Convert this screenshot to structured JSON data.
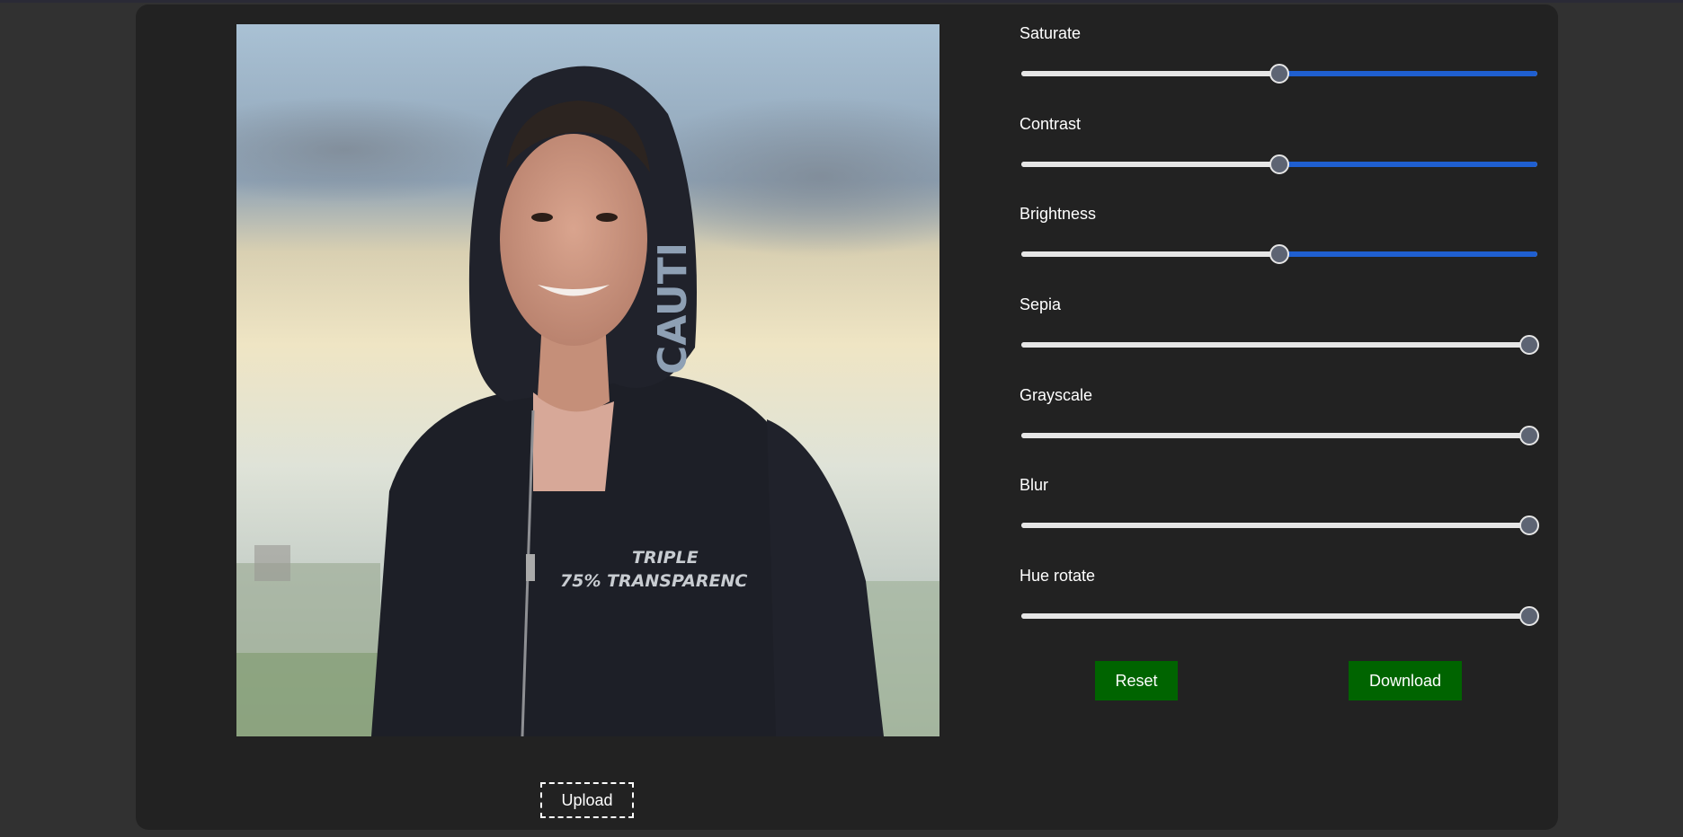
{
  "image": {
    "alt_caption_printed_on_hoodie": "TRIPLE",
    "hoodie_line2": "75% TRANSPARENC",
    "hood_text": "CAUTI"
  },
  "upload": {
    "label": "Upload"
  },
  "controls": [
    {
      "label": "Saturate",
      "value_fraction": 0.5,
      "filled_right": true
    },
    {
      "label": "Contrast",
      "value_fraction": 0.5,
      "filled_right": true
    },
    {
      "label": "Brightness",
      "value_fraction": 0.5,
      "filled_right": true
    },
    {
      "label": "Sepia",
      "value_fraction": 0.98,
      "filled_right": false
    },
    {
      "label": "Grayscale",
      "value_fraction": 0.98,
      "filled_right": false
    },
    {
      "label": "Blur",
      "value_fraction": 0.98,
      "filled_right": false
    },
    {
      "label": "Hue rotate",
      "value_fraction": 0.98,
      "filled_right": false
    }
  ],
  "buttons": {
    "reset": "Reset",
    "download": "Download"
  },
  "colors": {
    "background": "#313131",
    "panel": "#222222",
    "button_green": "#006400",
    "slider_active_blue": "#1f5fd0"
  }
}
